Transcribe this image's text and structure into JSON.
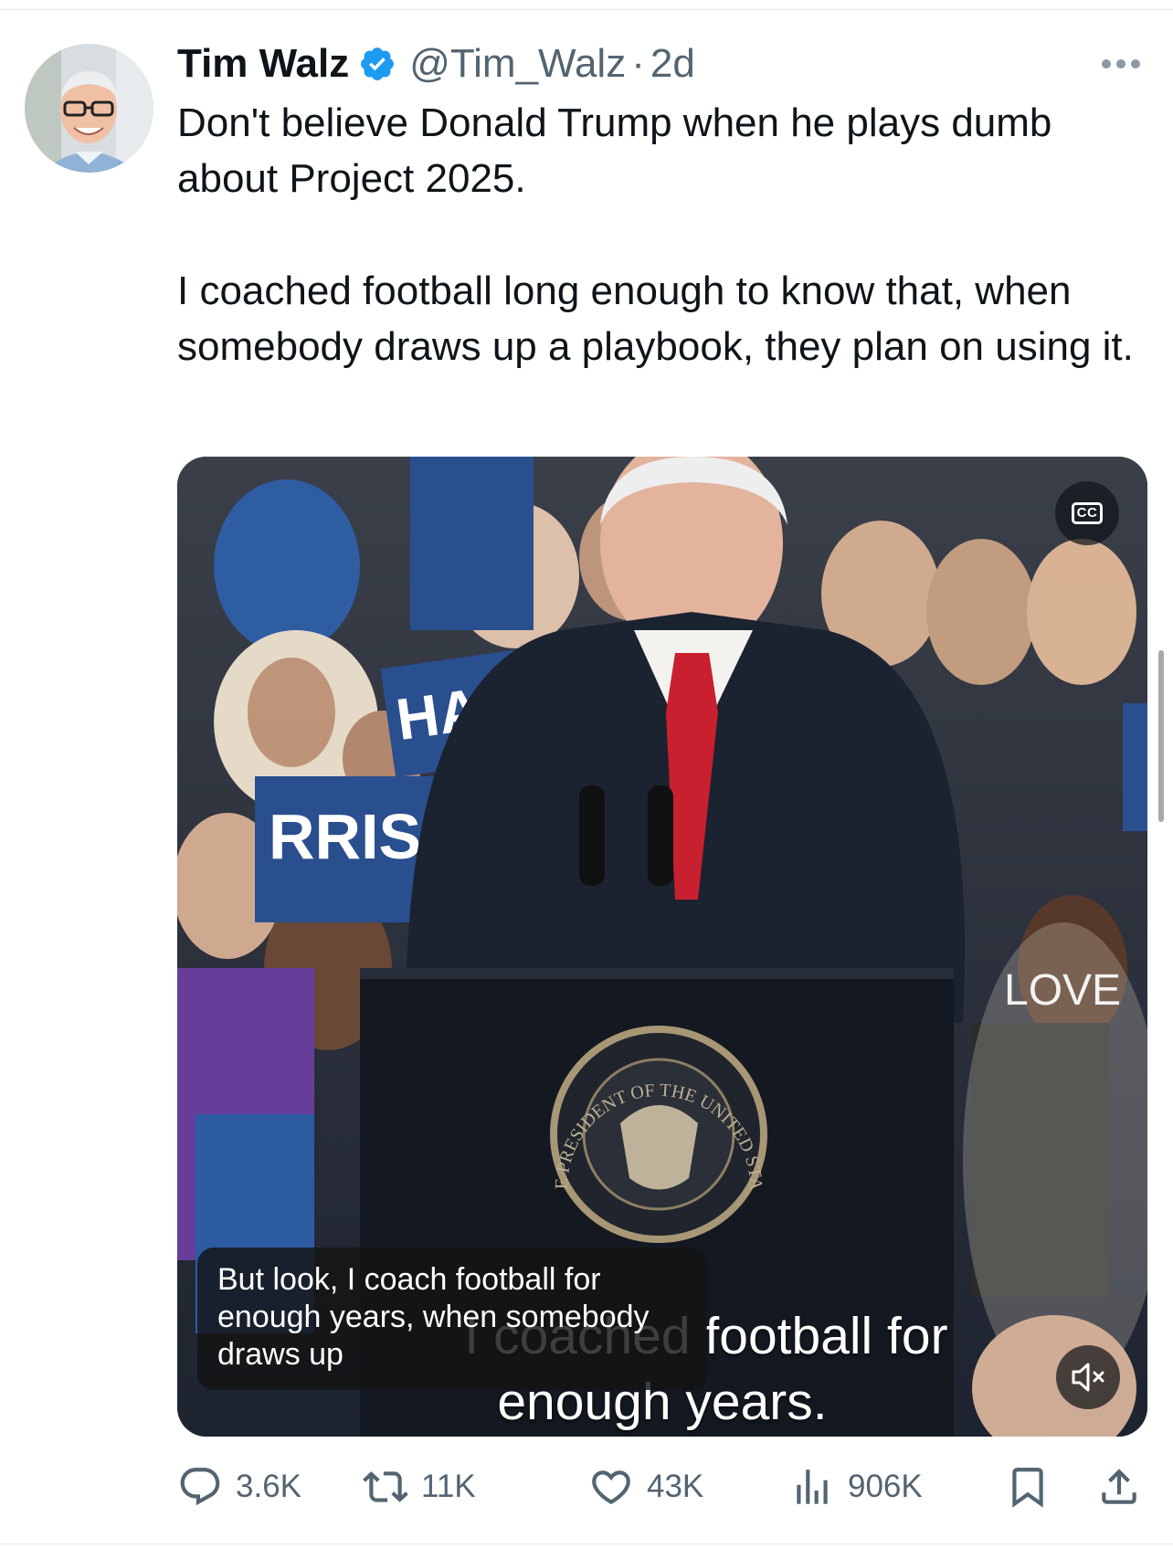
{
  "tweet": {
    "author": {
      "name": "Tim Walz",
      "handle": "@Tim_Walz",
      "separator": "·",
      "time": "2d",
      "verified_icon": "verified-badge-icon",
      "verified_color": "#1d9bf0"
    },
    "text": {
      "paragraph1": "Don't believe Donald Trump when he plays dumb about Project 2025.",
      "paragraph2": "I coached football long enough to know that, when somebody draws up a playbook, they plan on using it."
    },
    "media": {
      "type": "video",
      "cc_label": "CC",
      "caption_overlay": "But look, I coach football for enough years, when somebody draws up",
      "burned_in_line1": "I coached football for",
      "burned_in_line2": "enough years.",
      "sign_text_left": "HARRIS",
      "sign_text_love": "LOVE",
      "seal_text": "VICE PRESIDENT OF THE UNITED STATES",
      "muted": true
    },
    "actions": {
      "replies": "3.6K",
      "reposts": "11K",
      "likes": "43K",
      "views": "906K"
    }
  },
  "colors": {
    "text_primary": "#0f1419",
    "text_secondary": "#536471",
    "accent": "#1d9bf0"
  }
}
